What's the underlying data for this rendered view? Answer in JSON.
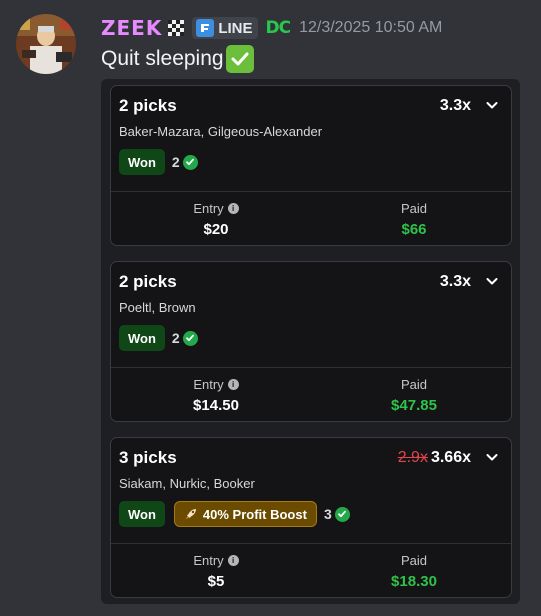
{
  "author": {
    "name": "ZEEK",
    "tag": "LINE",
    "badge": "DC",
    "timestamp": "12/3/2025 10:50 AM"
  },
  "message": {
    "text": "Quit sleeping"
  },
  "cards": [
    {
      "title": "2 picks",
      "multiplier_old": "",
      "multiplier": "3.3x",
      "players": "Baker-Mazara, Gilgeous-Alexander",
      "status": "Won",
      "boost": "",
      "hits": "2",
      "entry_label": "Entry",
      "entry": "$20",
      "paid_label": "Paid",
      "paid": "$66"
    },
    {
      "title": "2 picks",
      "multiplier_old": "",
      "multiplier": "3.3x",
      "players": "Poeltl, Brown",
      "status": "Won",
      "boost": "",
      "hits": "2",
      "entry_label": "Entry",
      "entry": "$14.50",
      "paid_label": "Paid",
      "paid": "$47.85"
    },
    {
      "title": "3 picks",
      "multiplier_old": "2.9x",
      "multiplier": "3.66x",
      "players": "Siakam, Nurkic, Booker",
      "status": "Won",
      "boost": "40% Profit Boost",
      "hits": "3",
      "entry_label": "Entry",
      "entry": "$5",
      "paid_label": "Paid",
      "paid": "$18.30"
    }
  ],
  "icons": {
    "chevron": "chevron-down-icon",
    "info": "info-icon",
    "check": "check-circle-icon",
    "rocket": "rocket-icon"
  },
  "colors": {
    "username": "#e58aff",
    "won_bg": "#0f4717",
    "paid_green": "#2ec249",
    "boost_bg": "#6b4b00",
    "strike_red": "#e0454b"
  }
}
